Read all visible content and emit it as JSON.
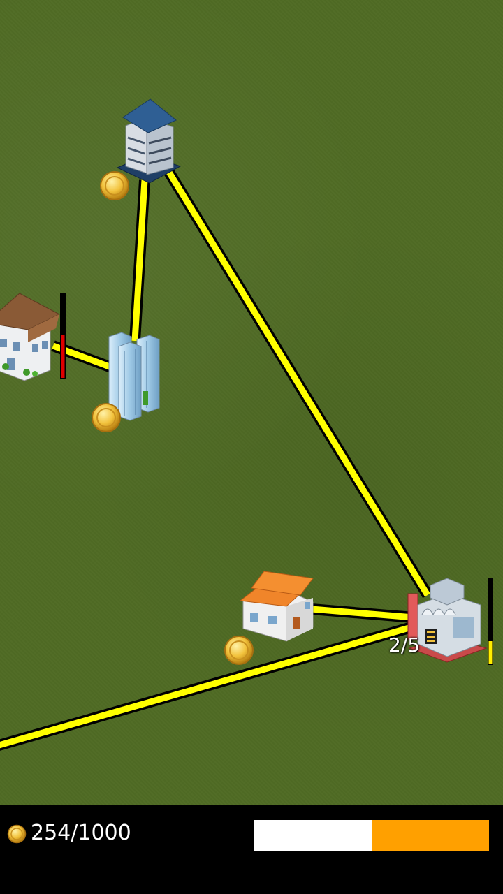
{
  "hud": {
    "money_current": "254",
    "money_separator": "/",
    "money_max": "1000",
    "progress_fraction": 0.5
  },
  "factory": {
    "counter_text": "2/5"
  },
  "colors": {
    "road": "#ffff00",
    "grass": "#4f6b24",
    "progress_fill": "#ffffff",
    "progress_track": "#ffa000",
    "gauge_red": "#e00000",
    "gauge_yellow": "#ffee00"
  }
}
